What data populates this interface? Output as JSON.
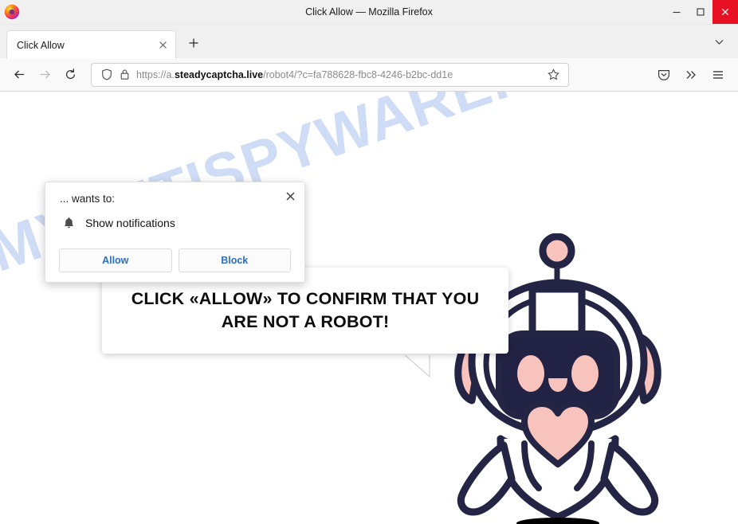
{
  "window": {
    "title": "Click Allow — Mozilla Firefox",
    "logo_icon": "firefox-logo",
    "minimize_label": "Minimize",
    "maximize_label": "Maximize",
    "close_label": "Close"
  },
  "tabbar": {
    "tabs": [
      {
        "title": "Click Allow",
        "close_label": "Close tab"
      }
    ],
    "new_tab_label": "+",
    "list_all_tabs_label": "List all tabs"
  },
  "navbar": {
    "back_label": "Back",
    "forward_label": "Forward",
    "reload_label": "Reload",
    "url_prefix": "https://a.",
    "url_host": "steadycaptcha.live",
    "url_path": "/robot4/?c=fa788628-fbc8-4246-b2bc-dd1e",
    "url_full": "https://a.steadycaptcha.live/robot4/?c=fa788628-fbc8-4246-b2bc-dd1e",
    "shield_icon": "tracking-protection-shield-icon",
    "lock_icon": "padlock-icon",
    "bookmark_icon": "star-icon",
    "pocket_icon": "pocket-save-icon",
    "overflow_icon": "double-chevron-icon",
    "menu_icon": "hamburger-menu-icon"
  },
  "doorhanger": {
    "origin_text": "... wants to:",
    "permission_icon": "bell-icon",
    "permission_label": "Show notifications",
    "allow_label": "Allow",
    "block_label": "Block",
    "close_label": "×",
    "button_text_color": "#2b6fc4"
  },
  "page": {
    "watermark": "MYANTISPYWARE.COM",
    "watermark_color": "#cfdcf5",
    "bubble_line1": "CLICK «ALLOW» TO CONFIRM THAT YOU",
    "bubble_line2": "ARE NOT A ROBOT!",
    "bubble_text": "CLICK «ALLOW» TO CONFIRM THAT YOU ARE NOT A ROBOT!",
    "robot_icon": "cartoon-robot-mascot",
    "robot_outline_color": "#242444",
    "robot_accent_color": "#f9c3bd",
    "robot_screen_color": "#222244",
    "robot_body_color": "#ffffff"
  }
}
